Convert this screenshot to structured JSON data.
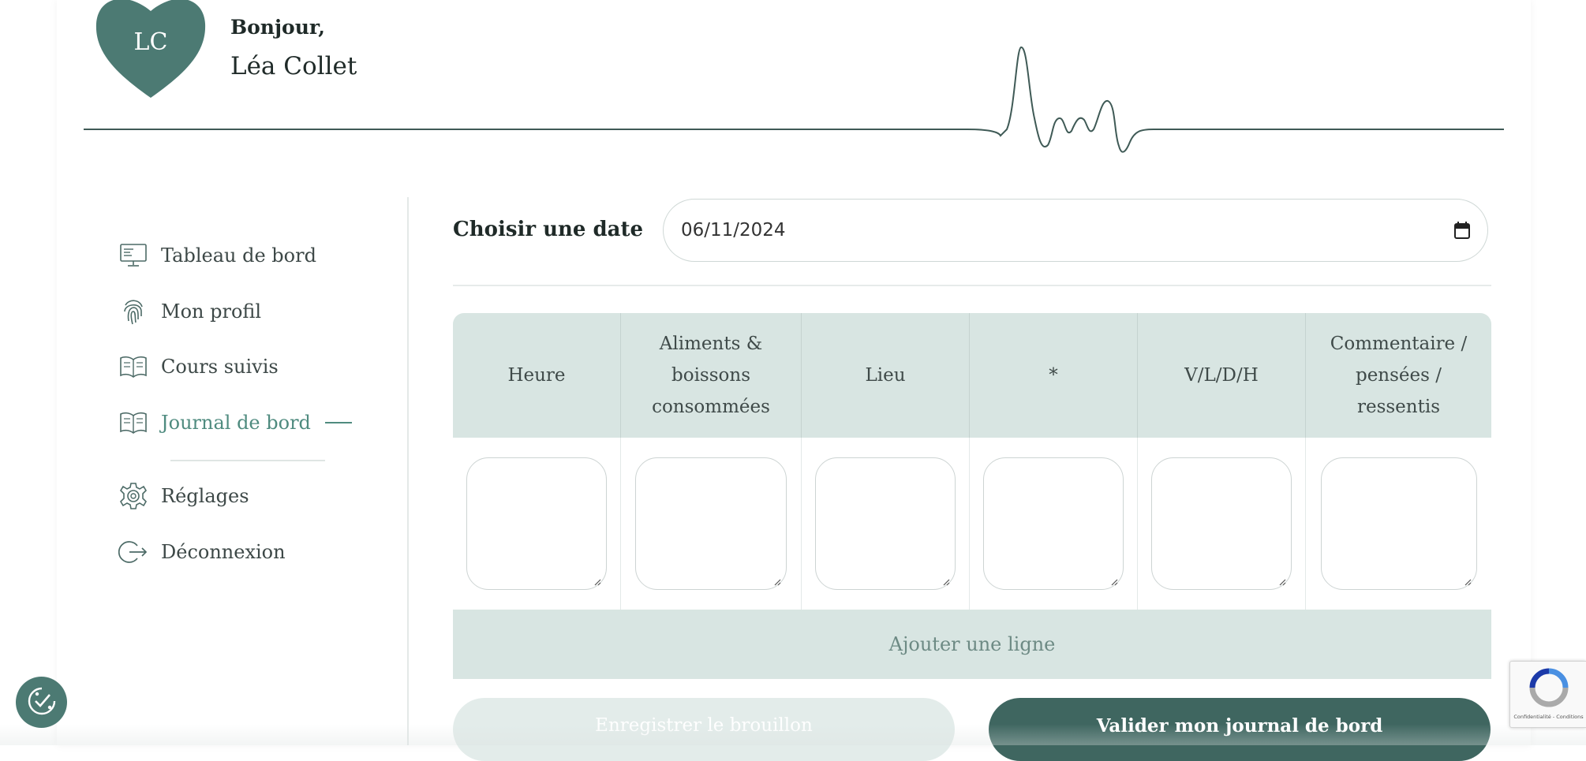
{
  "header": {
    "avatar_initials": "LC",
    "greeting": "Bonjour,",
    "user_name": "Léa Collet"
  },
  "sidebar": {
    "items": [
      {
        "label": "Tableau de bord",
        "icon": "monitor-icon"
      },
      {
        "label": "Mon profil",
        "icon": "fingerprint-icon"
      },
      {
        "label": "Cours suivis",
        "icon": "open-book-icon"
      },
      {
        "label": "Journal de bord",
        "icon": "open-book-icon",
        "active": true
      },
      {
        "label": "Réglages",
        "icon": "gear-icon"
      },
      {
        "label": "Déconnexion",
        "icon": "logout-icon"
      }
    ]
  },
  "main": {
    "date_label": "Choisir une date",
    "date_value": "06/11/2024",
    "table": {
      "headers": [
        "Heure",
        "Aliments & boissons consommées",
        "Lieu",
        "*",
        "V/L/D/H",
        "Commentaire / pensées / ressentis"
      ],
      "rows": [
        [
          "",
          "",
          "",
          "",
          "",
          ""
        ]
      ],
      "add_row_label": "Ajouter une ligne"
    },
    "buttons": {
      "draft": "Enregistrer le brouillon",
      "validate": "Valider mon journal de bord"
    }
  },
  "recaptcha": {
    "links": "Confidentialité - Conditions"
  },
  "colors": {
    "accent": "#4f8b7f",
    "dark_teal": "#3f6660",
    "avatar": "#4c7a73",
    "table_header": "#d8e5e2"
  }
}
